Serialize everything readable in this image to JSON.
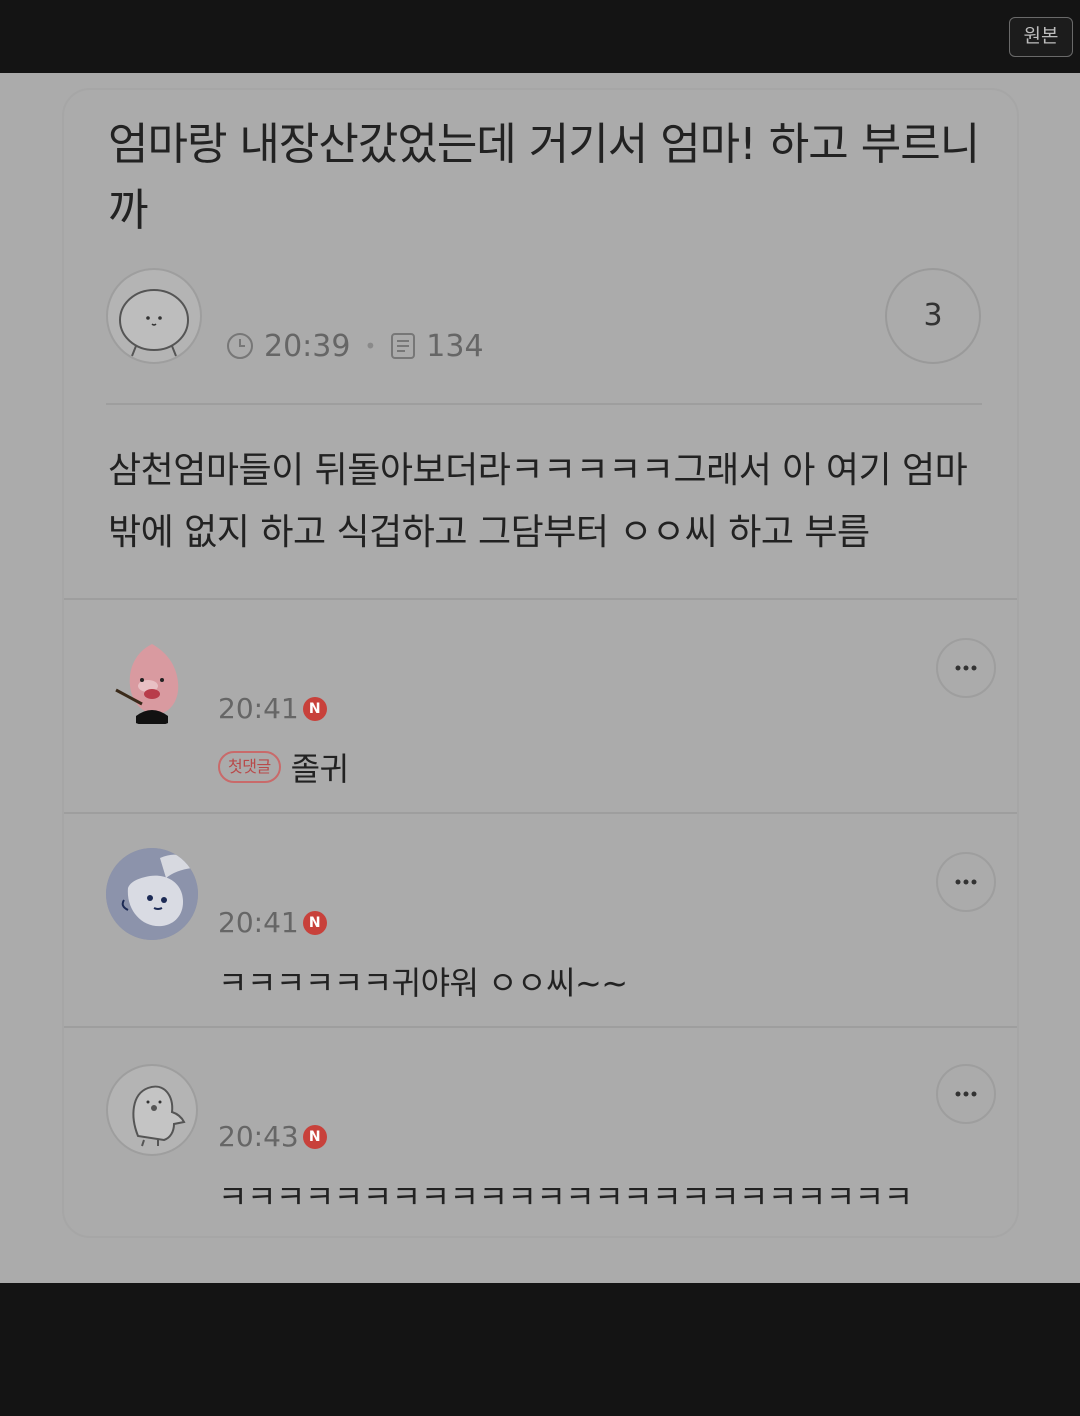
{
  "header": {
    "original_button": "원본"
  },
  "post": {
    "title": "엄마랑 내장산갔었는데 거기서 엄마! 하고 부르니까",
    "time": "20:39",
    "views": "134",
    "comment_count": "3",
    "body": "삼천엄마들이 뒤돌아보더라ㅋㅋㅋㅋㅋ그래서 아 여기 엄마밖에 없지 하고 식겁하고 그담부터 ㅇㅇ씨 하고 부름"
  },
  "comments": [
    {
      "time": "20:41",
      "badge": "N",
      "first_label": "첫댓글",
      "text": "졸귀",
      "avatar": "peach-avatar"
    },
    {
      "time": "20:41",
      "badge": "N",
      "text": "ㅋㅋㅋㅋㅋㅋ귀야워 ㅇㅇ씨~~",
      "avatar": "bunny-avatar"
    },
    {
      "time": "20:43",
      "badge": "N",
      "text": "ㅋㅋㅋㅋㅋㅋㅋㅋㅋㅋㅋㅋㅋㅋㅋㅋㅋㅋㅋㅋㅋㅋㅋㅋ",
      "avatar": "ghost-avatar"
    }
  ],
  "icons": {
    "clock": "clock-icon",
    "views": "document-icon",
    "more": "more-dots-icon"
  },
  "colors": {
    "badge_new": "#c8413b",
    "first_badge": "#b84a4a"
  }
}
